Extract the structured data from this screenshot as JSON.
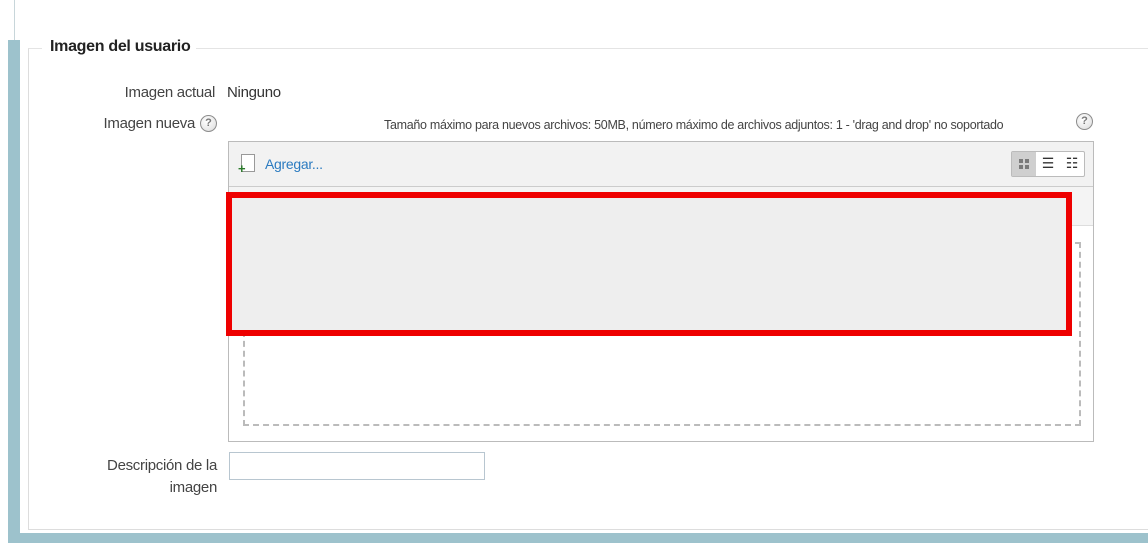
{
  "section": {
    "legend": "Imagen del usuario"
  },
  "current_image": {
    "label": "Imagen actual",
    "value": "Ninguno"
  },
  "new_image": {
    "label": "Imagen nueva",
    "help_glyph": "?",
    "max_size_text": "Tamaño máximo para nuevos archivos: 50MB, número máximo de archivos adjuntos: 1 - 'drag and drop' no soportado",
    "add_label": "Agregar...",
    "view_icons": [
      "grid-view-icon",
      "list-view-icon",
      "tree-view-icon"
    ],
    "list_glyph": "☰",
    "tree_glyph": "☷"
  },
  "description": {
    "label_line1": "Descripción de la",
    "label_line2": "imagen",
    "value": ""
  },
  "colors": {
    "frame": "#9dc2cc",
    "highlight": "#ee0000",
    "link": "#2b7bc0"
  }
}
